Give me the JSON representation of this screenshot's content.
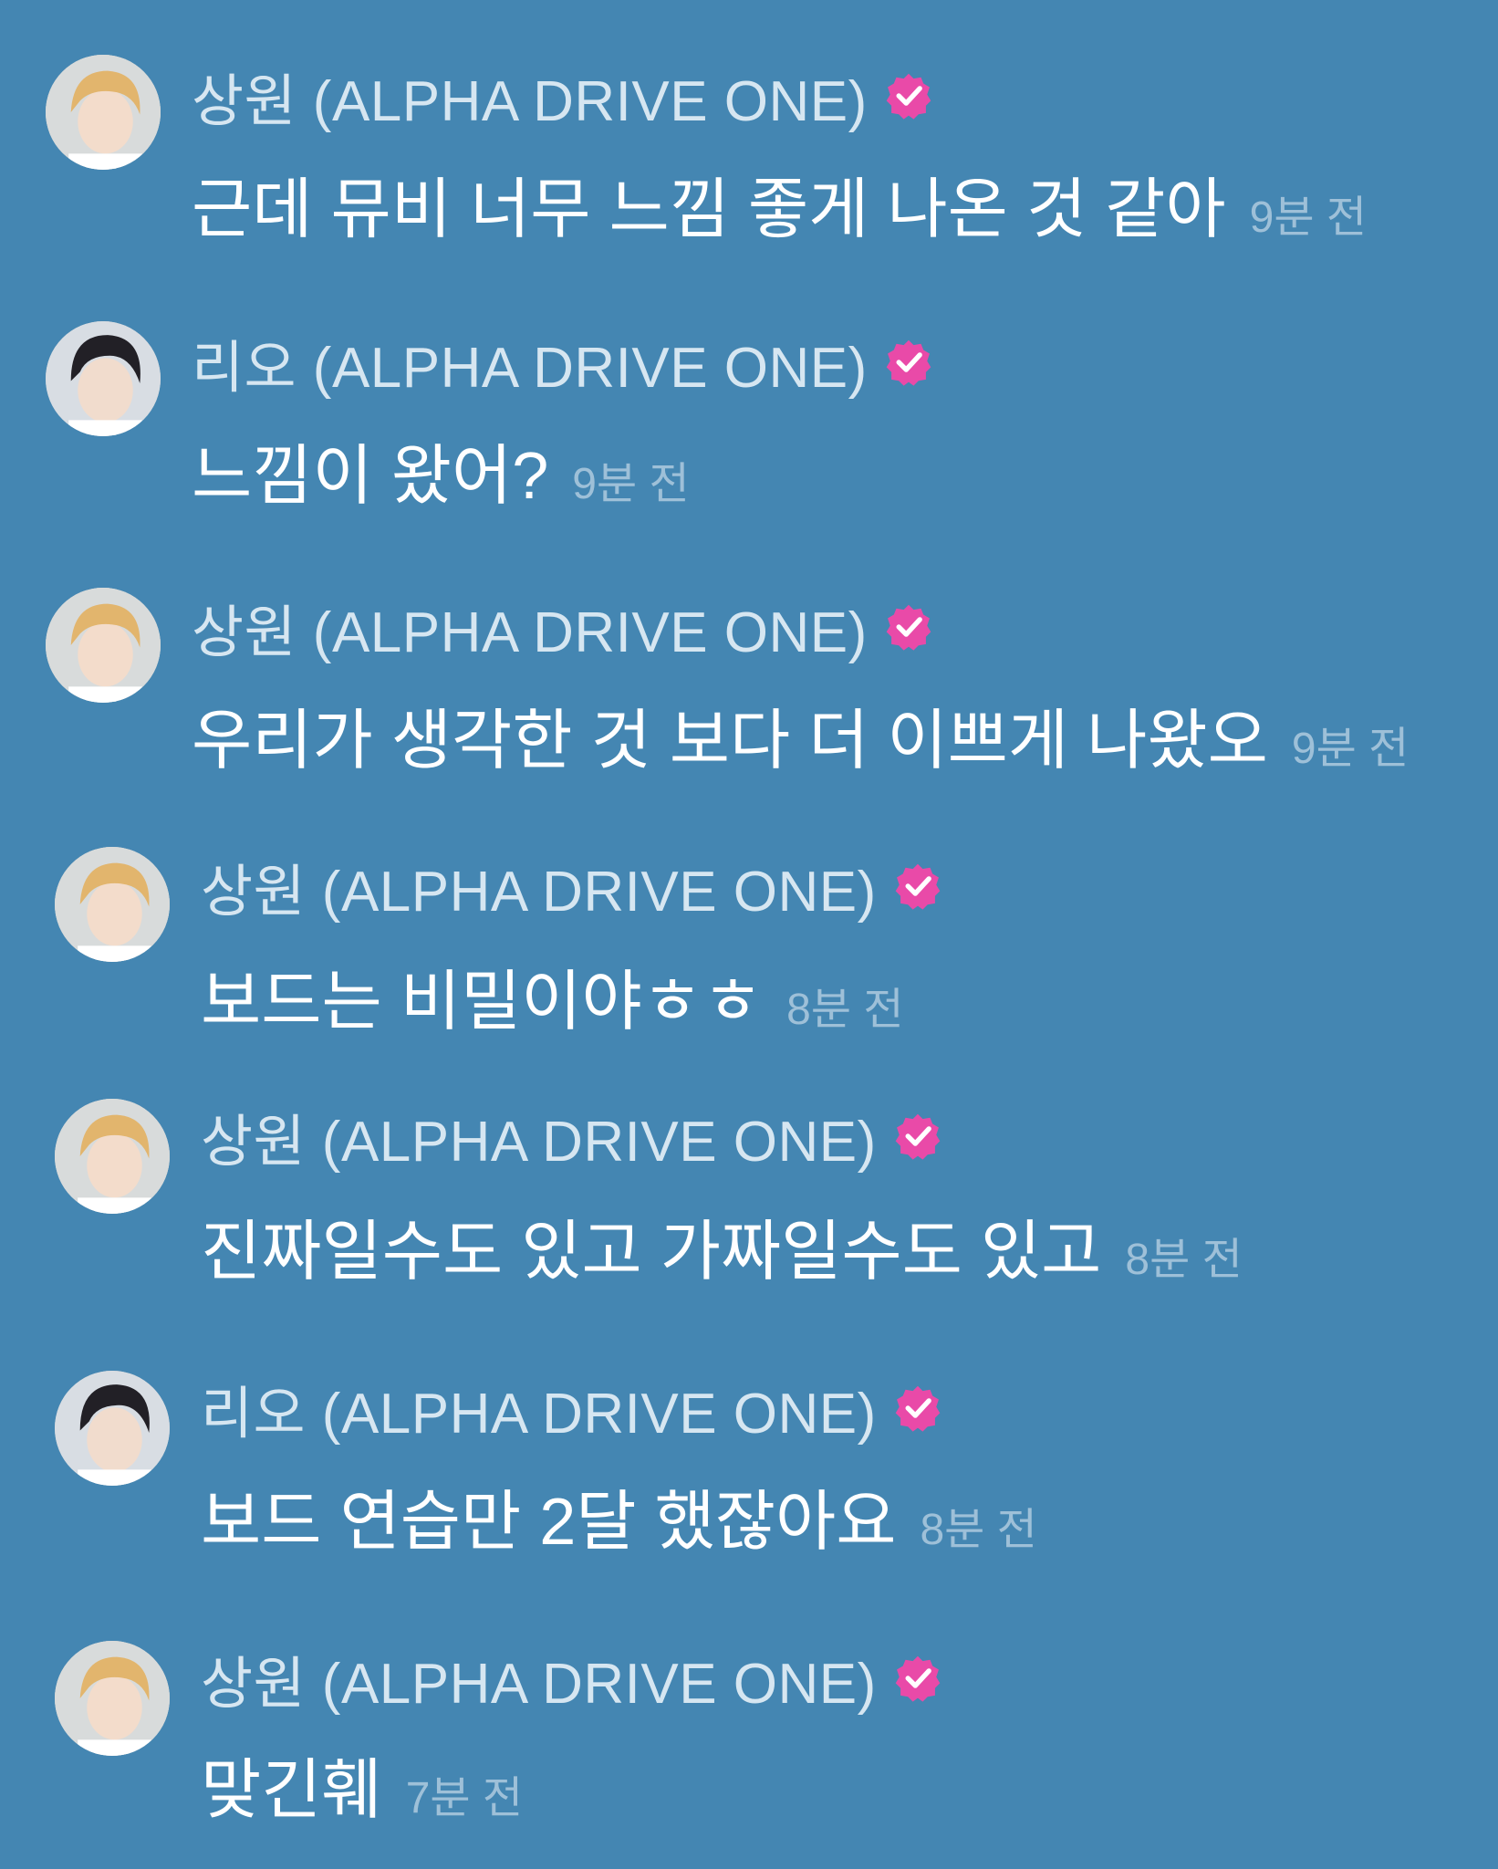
{
  "colors": {
    "background": "#4486b2",
    "author_name": "#d6e6f1",
    "message_text": "#ffffff",
    "timestamp": "#9ec0d8",
    "verified_badge": "#e94aa8"
  },
  "messages": [
    {
      "author": "상원 (ALPHA DRIVE ONE)",
      "avatar": "blonde",
      "verified_icon": "verified-check-icon",
      "text": "근데 뮤비 너무 느낌 좋게 나온 것 같아",
      "time": "9분 전"
    },
    {
      "author": "리오 (ALPHA DRIVE ONE)",
      "avatar": "dark",
      "verified_icon": "verified-check-icon",
      "text": "느낌이 왔어?",
      "time": "9분 전"
    },
    {
      "author": "상원 (ALPHA DRIVE ONE)",
      "avatar": "blonde",
      "verified_icon": "verified-check-icon",
      "text": "우리가 생각한 것 보다 더 이쁘게 나왔오",
      "time": "9분 전"
    },
    {
      "author": "상원 (ALPHA DRIVE ONE)",
      "avatar": "blonde",
      "verified_icon": "verified-check-icon",
      "text": "보드는 비밀이야ㅎㅎ",
      "time": "8분 전"
    },
    {
      "author": "상원 (ALPHA DRIVE ONE)",
      "avatar": "blonde",
      "verified_icon": "verified-check-icon",
      "text": "진짜일수도 있고 가짜일수도 있고",
      "time": "8분 전"
    },
    {
      "author": "리오 (ALPHA DRIVE ONE)",
      "avatar": "dark",
      "verified_icon": "verified-check-icon",
      "text": "보드 연습만 2달 했잖아요",
      "time": "8분 전"
    },
    {
      "author": "상원 (ALPHA DRIVE ONE)",
      "avatar": "blonde",
      "verified_icon": "verified-check-icon",
      "text": "맞긴훼",
      "time": "7분 전"
    }
  ]
}
